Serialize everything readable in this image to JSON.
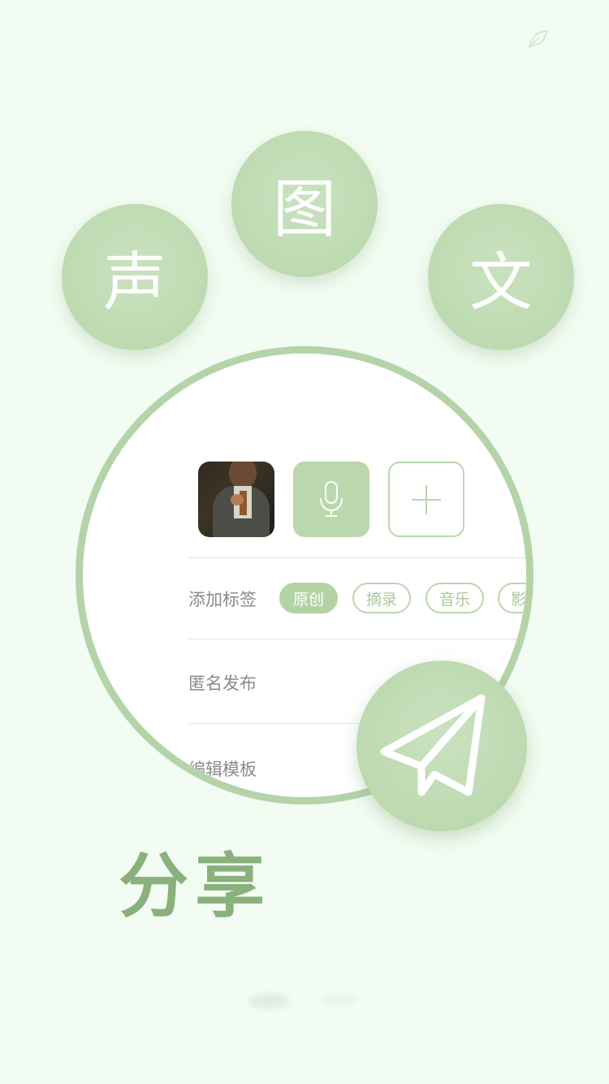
{
  "theme": {
    "background": "#f2fcf2",
    "accent": "#bad7ad",
    "title_color": "#8ab07c"
  },
  "top_icon": "leaf-icon",
  "bubbles": {
    "voice": "声",
    "image": "图",
    "text": "文"
  },
  "media": {
    "photo_icon": "portrait-photo",
    "mic_icon": "microphone-icon",
    "add_icon": "plus-icon"
  },
  "tags": {
    "label": "添加标签",
    "items": [
      "原创",
      "摘录",
      "音乐",
      "影视"
    ]
  },
  "anonymous": {
    "label": "匿名发布"
  },
  "template": {
    "label": "编辑模板"
  },
  "send_icon": "paper-plane-icon",
  "title": "分享"
}
